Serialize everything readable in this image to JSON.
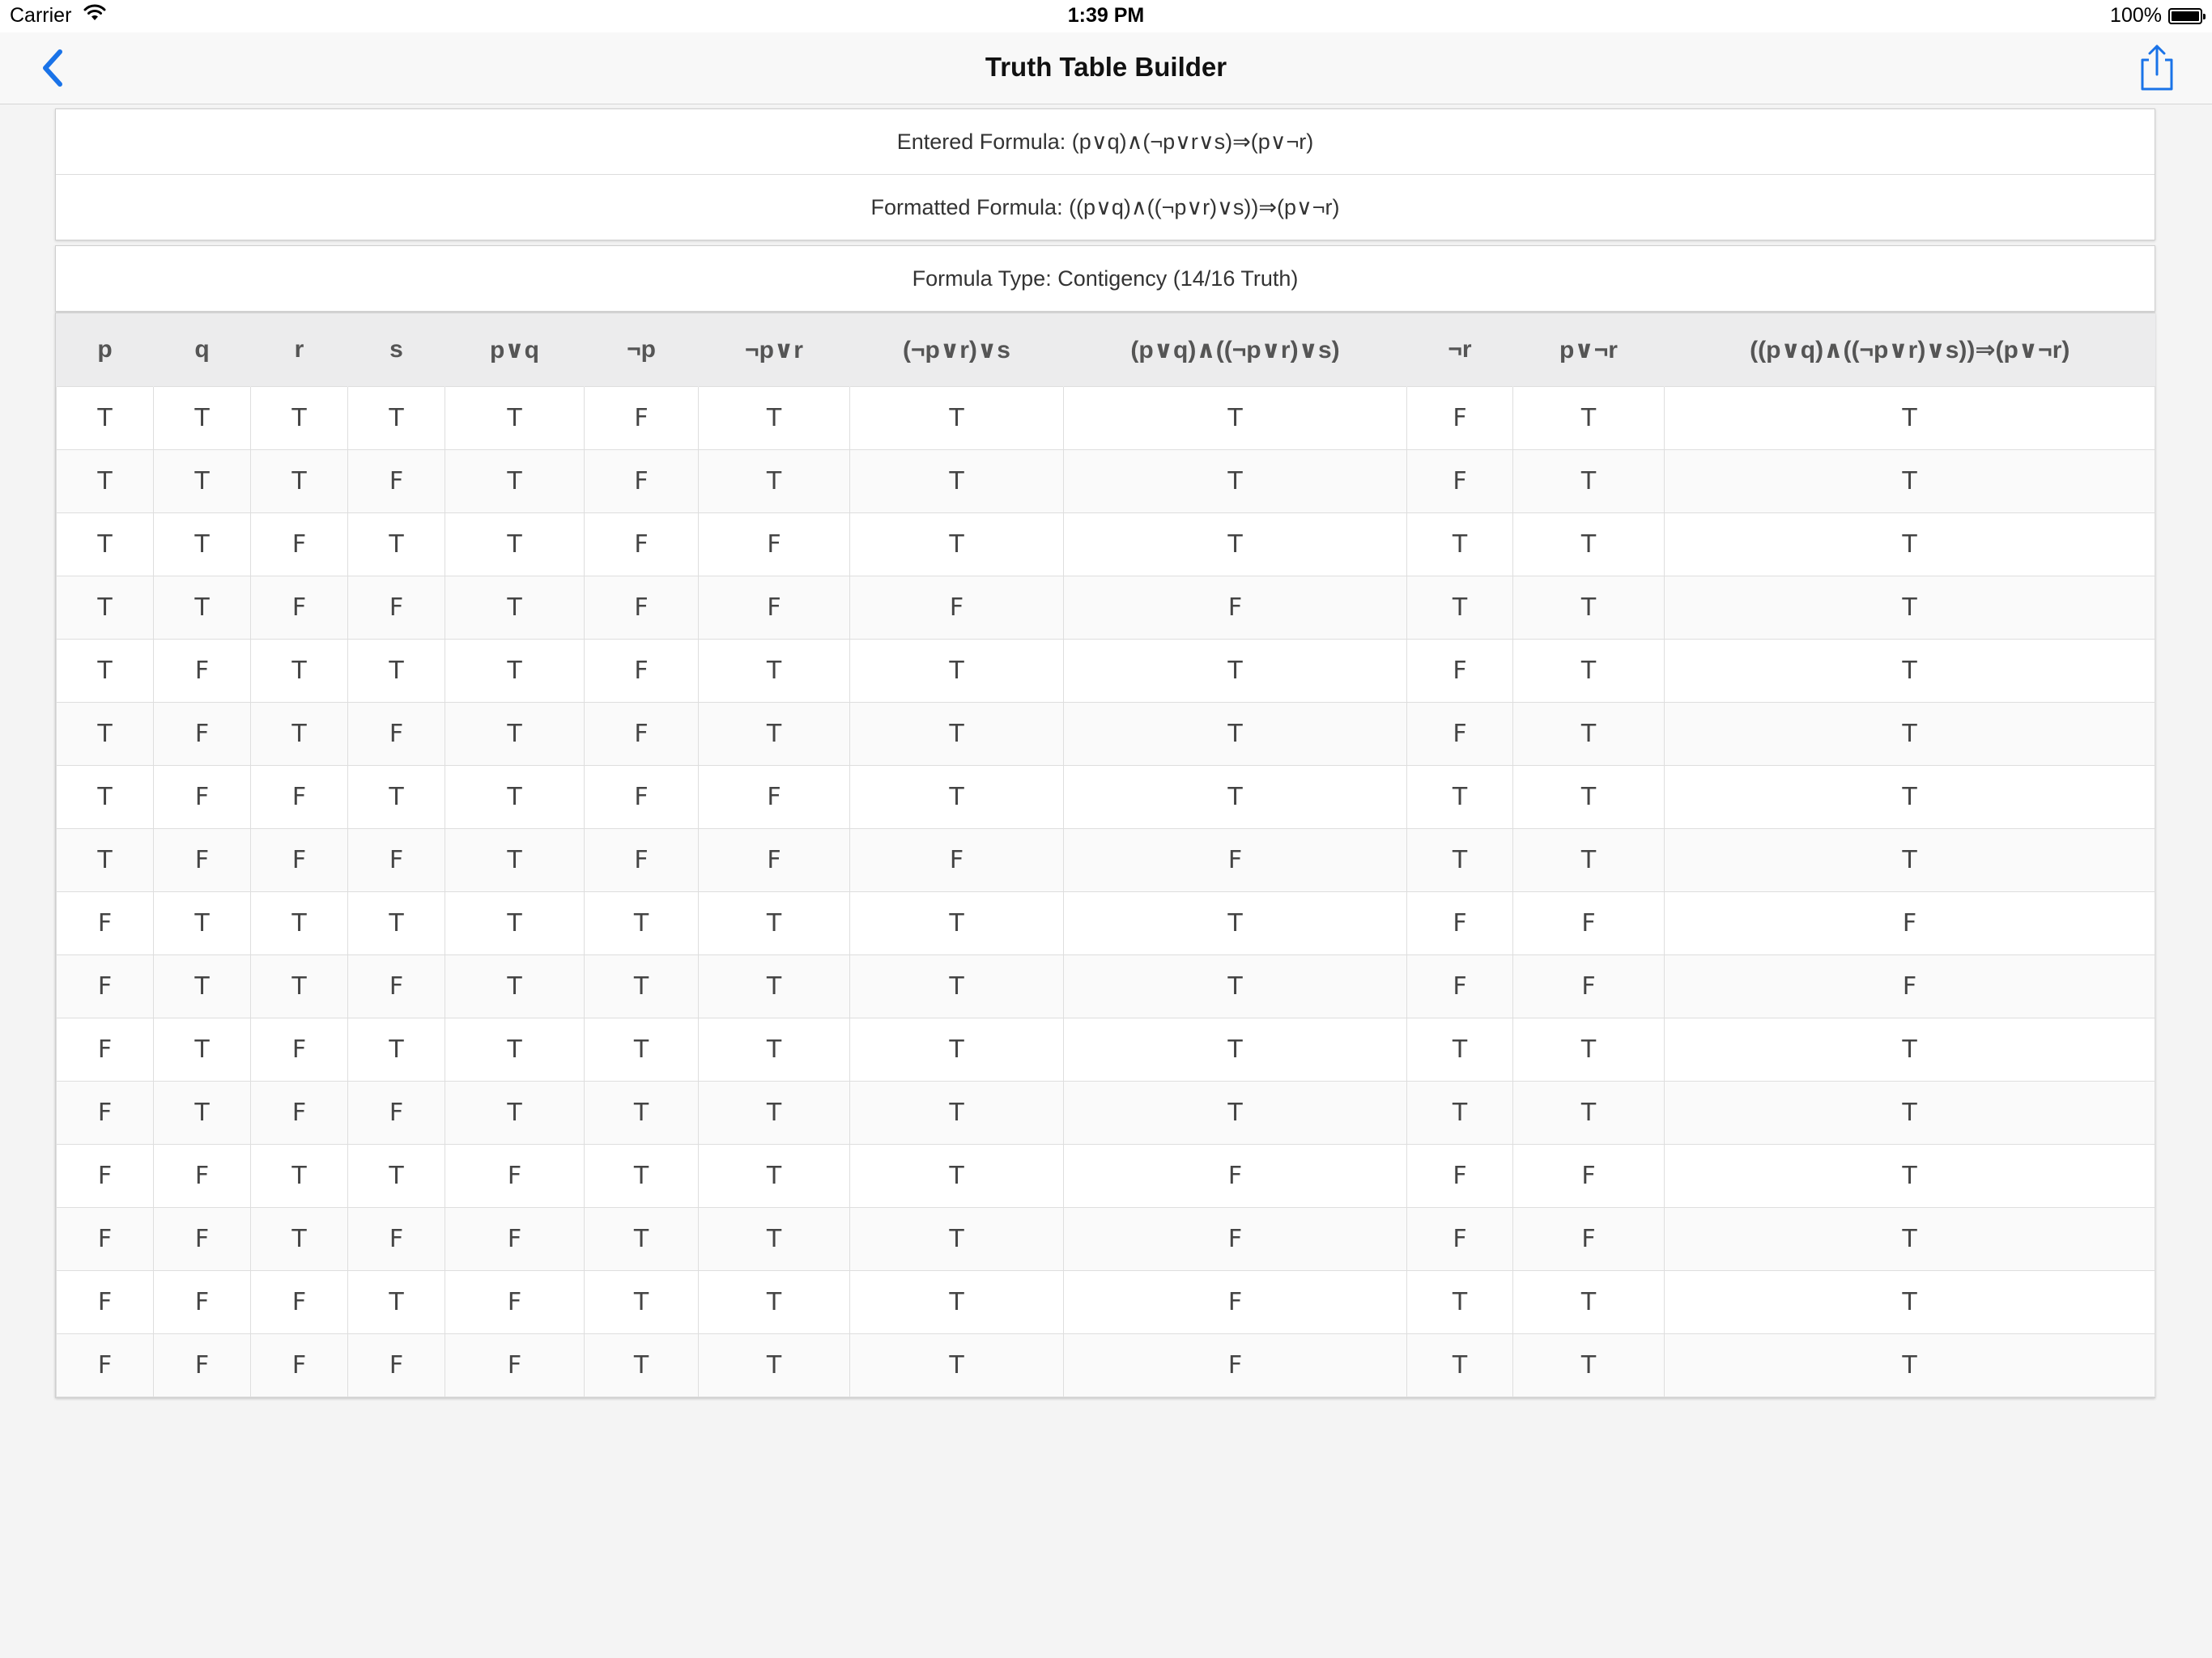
{
  "status_bar": {
    "carrier": "Carrier",
    "time": "1:39 PM",
    "battery": "100%"
  },
  "nav": {
    "title": "Truth Table Builder",
    "back_icon": "chevron-left-icon",
    "share_icon": "share-icon",
    "accent_color": "#1a73e8"
  },
  "formula": {
    "entered": "Entered Formula: (p∨q)∧(¬p∨r∨s)⇒(p∨¬r)",
    "formatted": "Formatted Formula: ((p∨q)∧((¬p∨r)∨s))⇒(p∨¬r)",
    "type": "Formula Type: Contigency (14/16 Truth)"
  },
  "table": {
    "headers": [
      "p",
      "q",
      "r",
      "s",
      "p∨q",
      "¬p",
      "¬p∨r",
      "(¬p∨r)∨s",
      "(p∨q)∧((¬p∨r)∨s)",
      "¬r",
      "p∨¬r",
      "((p∨q)∧((¬p∨r)∨s))⇒(p∨¬r)"
    ],
    "rows": [
      [
        "T",
        "T",
        "T",
        "T",
        "T",
        "F",
        "T",
        "T",
        "T",
        "F",
        "T",
        "T"
      ],
      [
        "T",
        "T",
        "T",
        "F",
        "T",
        "F",
        "T",
        "T",
        "T",
        "F",
        "T",
        "T"
      ],
      [
        "T",
        "T",
        "F",
        "T",
        "T",
        "F",
        "F",
        "T",
        "T",
        "T",
        "T",
        "T"
      ],
      [
        "T",
        "T",
        "F",
        "F",
        "T",
        "F",
        "F",
        "F",
        "F",
        "T",
        "T",
        "T"
      ],
      [
        "T",
        "F",
        "T",
        "T",
        "T",
        "F",
        "T",
        "T",
        "T",
        "F",
        "T",
        "T"
      ],
      [
        "T",
        "F",
        "T",
        "F",
        "T",
        "F",
        "T",
        "T",
        "T",
        "F",
        "T",
        "T"
      ],
      [
        "T",
        "F",
        "F",
        "T",
        "T",
        "F",
        "F",
        "T",
        "T",
        "T",
        "T",
        "T"
      ],
      [
        "T",
        "F",
        "F",
        "F",
        "T",
        "F",
        "F",
        "F",
        "F",
        "T",
        "T",
        "T"
      ],
      [
        "F",
        "T",
        "T",
        "T",
        "T",
        "T",
        "T",
        "T",
        "T",
        "F",
        "F",
        "F"
      ],
      [
        "F",
        "T",
        "T",
        "F",
        "T",
        "T",
        "T",
        "T",
        "T",
        "F",
        "F",
        "F"
      ],
      [
        "F",
        "T",
        "F",
        "T",
        "T",
        "T",
        "T",
        "T",
        "T",
        "T",
        "T",
        "T"
      ],
      [
        "F",
        "T",
        "F",
        "F",
        "T",
        "T",
        "T",
        "T",
        "T",
        "T",
        "T",
        "T"
      ],
      [
        "F",
        "F",
        "T",
        "T",
        "F",
        "T",
        "T",
        "T",
        "F",
        "F",
        "F",
        "T"
      ],
      [
        "F",
        "F",
        "T",
        "F",
        "F",
        "T",
        "T",
        "T",
        "F",
        "F",
        "F",
        "T"
      ],
      [
        "F",
        "F",
        "F",
        "T",
        "F",
        "T",
        "T",
        "T",
        "F",
        "T",
        "T",
        "T"
      ],
      [
        "F",
        "F",
        "F",
        "F",
        "F",
        "T",
        "T",
        "T",
        "F",
        "T",
        "T",
        "T"
      ]
    ]
  }
}
